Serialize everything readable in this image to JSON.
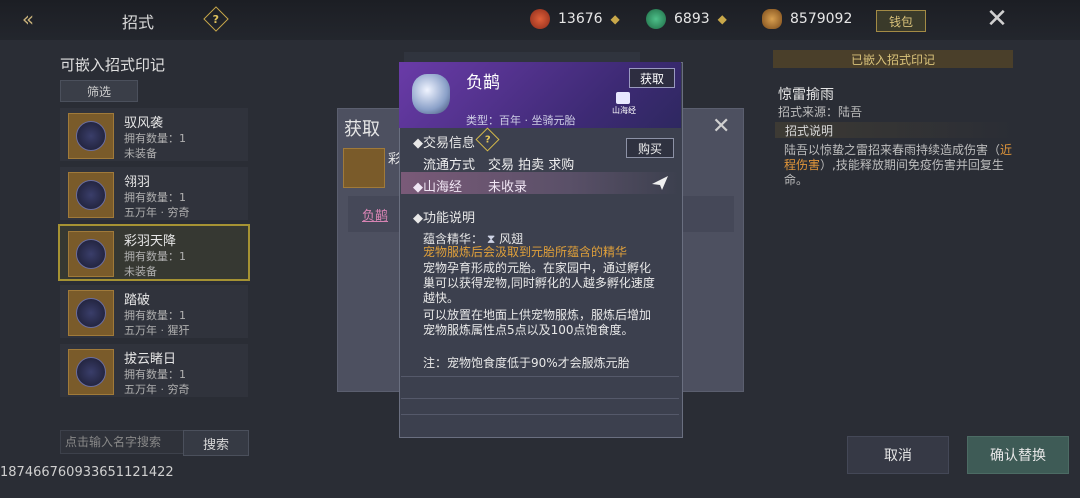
{
  "header": {
    "title": "招式",
    "help_icon": "?",
    "currencies": [
      {
        "icon": "red-coin-icon",
        "value": "13676",
        "color": "#c2402a"
      },
      {
        "icon": "jade-icon",
        "value": "6893",
        "color": "#2f8a5a"
      },
      {
        "icon": "gold-leaf-icon",
        "value": "8579092",
        "color": "#a6783a"
      }
    ],
    "wallet_label": "钱包"
  },
  "left": {
    "title": "可嵌入招式印记",
    "filter_label": "筛选",
    "items": [
      {
        "name": "驭风袭",
        "count": "拥有数量：1",
        "status": "未装备"
      },
      {
        "name": "翎羽",
        "count": "拥有数量：1",
        "status": "五万年 · 穷奇"
      },
      {
        "name": "彩羽天降",
        "count": "拥有数量：1",
        "status": "未装备"
      },
      {
        "name": "踏破",
        "count": "拥有数量：1",
        "status": "五万年 · 猩犴"
      },
      {
        "name": "拔云睹日",
        "count": "拥有数量：1",
        "status": "五万年 · 穷奇"
      }
    ],
    "search_placeholder": "点击输入名字搜索",
    "search_label": "搜索"
  },
  "bottom_id": "187466760933651121422",
  "get_panel": {
    "title": "获取",
    "item_name": "彩",
    "link_text": "负鹋"
  },
  "popup": {
    "name": "负鹋",
    "get_label": "获取",
    "type": "类型：百年 · 坐骑元胎",
    "book_label": "山海经",
    "trade_title": "交易信息",
    "buy_label": "购买",
    "trade_methods": "流通方式　交易 拍卖 求购",
    "source_name": "山海经",
    "source_state": "未收录",
    "func_title": "功能说明",
    "essence_label": "蕴含精华：",
    "essence_value": "风翅",
    "desc_highlight": "宠物服炼后会汲取到元胎所蕴含的精华",
    "desc1": "宠物孕育形成的元胎。在家园中，通过孵化巢可以获得宠物,同时孵化的人越多孵化速度越快。",
    "desc2": "可以放置在地面上供宠物服炼，服炼后增加宠物服炼属性点5点以及100点饱食度。",
    "desc3": "注：宠物饱食度低于90%才会服炼元胎"
  },
  "right": {
    "header": "已嵌入招式印记",
    "skill_name": "惊雷揄雨",
    "skill_source": "招式来源：陆吾",
    "desc_head": "招式说明",
    "desc_pre": "陆吾以惊蛰之雷招来春雨持续造成伤害（",
    "desc_hl": "近程伤害",
    "desc_post": "）,技能释放期间免疫伤害并回复生命。",
    "cancel_label": "取消",
    "confirm_label": "确认替换"
  }
}
